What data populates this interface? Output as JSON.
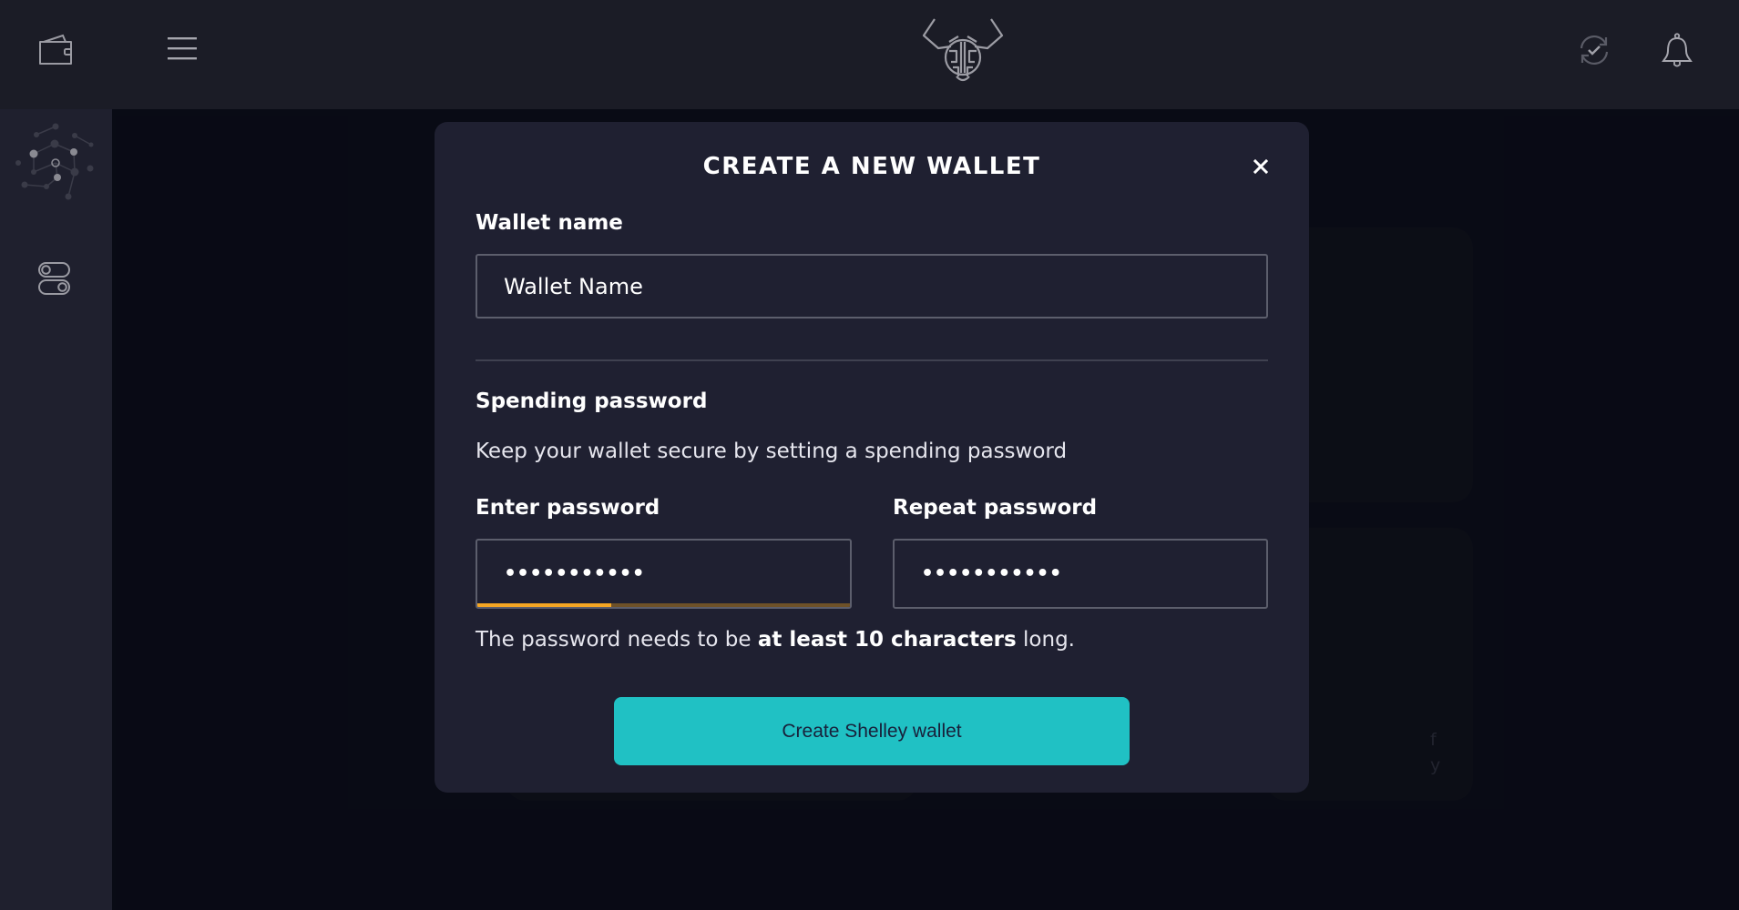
{
  "app": {
    "logo_name": "bull-head-logo",
    "colors": {
      "accent": "#20c1c4",
      "strength_fill": "#f5a623",
      "strength_track": "#6e5128",
      "modal_bg": "#1f2031",
      "page_bg": "#0b0c17"
    }
  },
  "sidebar": {
    "items": [
      {
        "name": "wallets",
        "icon": "wallet-icon"
      },
      {
        "name": "network",
        "icon": "network-icon"
      },
      {
        "name": "settings",
        "icon": "toggle-settings-icon"
      }
    ]
  },
  "header": {
    "menu_icon": "hamburger-menu-icon",
    "right_icons": [
      "sync-status-icon",
      "bell-notification-icon"
    ]
  },
  "background": {
    "card_text_fragments": [
      "f",
      "y"
    ]
  },
  "modal": {
    "title": "CREATE A NEW WALLET",
    "close_label": "✕",
    "wallet_name": {
      "label": "Wallet name",
      "value": "Wallet Name"
    },
    "spending_password": {
      "section_title": "Spending password",
      "description": "Keep your wallet secure by setting a spending password",
      "enter_label": "Enter password",
      "enter_value": "•••••••••••",
      "repeat_label": "Repeat password",
      "repeat_value": "•••••••••••",
      "strength_percent": 36,
      "hint_prefix": "The password needs to be ",
      "hint_bold": "at least 10 characters",
      "hint_suffix": " long."
    },
    "submit_label": "Create Shelley wallet"
  }
}
